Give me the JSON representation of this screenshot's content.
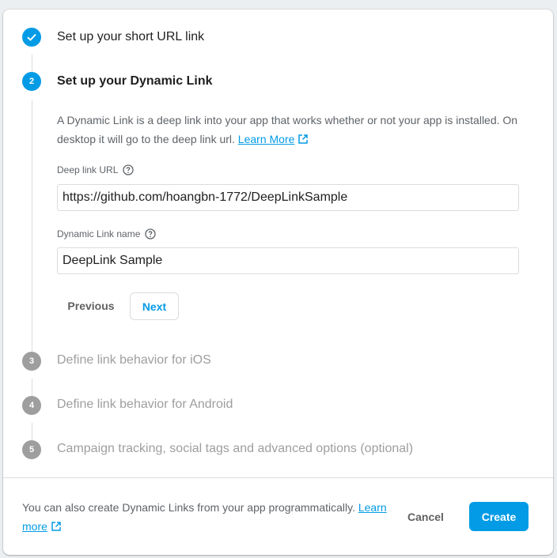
{
  "steps": [
    {
      "number": "",
      "title": "Set up your short URL link",
      "state": "completed"
    },
    {
      "number": "2",
      "title": "Set up your Dynamic Link",
      "state": "active"
    },
    {
      "number": "3",
      "title": "Define link behavior for iOS",
      "state": "inactive"
    },
    {
      "number": "4",
      "title": "Define link behavior for Android",
      "state": "inactive"
    },
    {
      "number": "5",
      "title": "Campaign tracking, social tags and advanced options (optional)",
      "state": "inactive"
    }
  ],
  "step2": {
    "description": "A Dynamic Link is a deep link into your app that works whether or not your app is installed. On desktop it will go to the deep link url.",
    "learn_more": "Learn More",
    "deep_link_label": "Deep link URL",
    "deep_link_value": "https://github.com/hoangbn-1772/DeepLinkSample",
    "name_label": "Dynamic Link name",
    "name_value": "DeepLink Sample",
    "previous_label": "Previous",
    "next_label": "Next"
  },
  "footer": {
    "text": "You can also create Dynamic Links from your app programmatically.",
    "learn_more": "Learn more",
    "cancel_label": "Cancel",
    "create_label": "Create"
  },
  "colors": {
    "accent": "#039be5",
    "inactive": "#9e9e9e",
    "text_secondary": "#5f6368"
  },
  "icons": [
    "check-icon",
    "help-circle-icon",
    "external-link-icon"
  ]
}
